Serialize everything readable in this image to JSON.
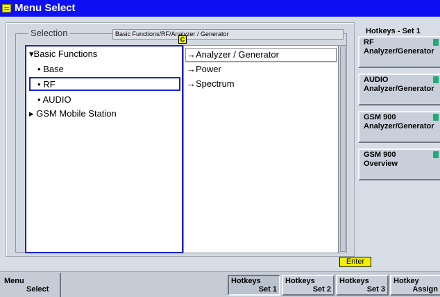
{
  "window": {
    "title": "Menu Select"
  },
  "selection": {
    "label": "Selection",
    "path": "Basic Functions/RF/Analyzer / Generator",
    "marker": "C"
  },
  "tree": [
    {
      "label": "Basic Functions",
      "prefix": "▾",
      "expanded": true
    },
    {
      "label": "Base",
      "prefix": "•"
    },
    {
      "label": "RF",
      "prefix": "•",
      "selected": true
    },
    {
      "label": "AUDIO",
      "prefix": "•"
    },
    {
      "label": "GSM Mobile Station",
      "prefix": "▸",
      "expanded": false
    }
  ],
  "list": [
    {
      "label": "Analyzer / Generator",
      "prefix": "→",
      "focused": true
    },
    {
      "label": "Power",
      "prefix": "→"
    },
    {
      "label": "Spectrum",
      "prefix": "→"
    }
  ],
  "enter_label": "Enter",
  "hotkeys": {
    "title": "Hotkeys - Set 1",
    "items": [
      {
        "line1": "RF",
        "line2": "Analyzer/Generator",
        "icon": "signal-icon"
      },
      {
        "line1": "AUDIO",
        "line2": "Analyzer/Generator",
        "icon": "speaker-icon"
      },
      {
        "line1": "GSM 900",
        "line2": "Analyzer/Generator",
        "icon": "gsm-icon"
      },
      {
        "line1": "GSM 900",
        "line2": "Overview",
        "icon": "overview-icon"
      }
    ]
  },
  "softkeys": {
    "menu": {
      "line1": "Menu",
      "line2": "Select"
    },
    "items": [
      {
        "line1": "Hotkeys",
        "line2": "Set 1",
        "active": true
      },
      {
        "line1": "Hotkeys",
        "line2": "Set 2"
      },
      {
        "line1": "Hotkeys",
        "line2": "Set 3"
      },
      {
        "line1": "Hotkey",
        "line2": "Assign"
      }
    ]
  },
  "colors": {
    "titlebar": "#0c10f2",
    "selection_border": "#1a24c8",
    "enter_key": "#f0f000",
    "hotkey_icon": "#1faa78"
  }
}
